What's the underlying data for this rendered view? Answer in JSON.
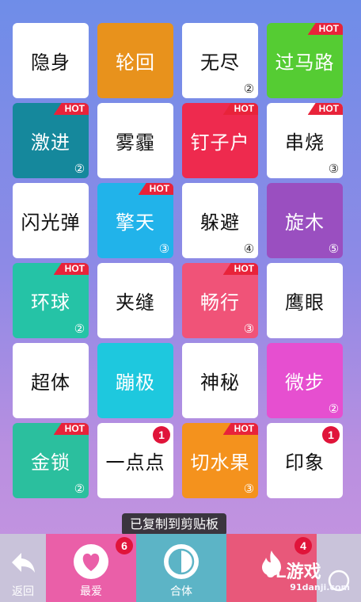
{
  "tiles": [
    {
      "word": "隐身",
      "bg": "#ffffff",
      "fg": "#111111",
      "hot": false,
      "level": "",
      "badge": ""
    },
    {
      "word": "轮回",
      "bg": "#e8921c",
      "fg": "#ffffff",
      "hot": false,
      "level": "",
      "badge": ""
    },
    {
      "word": "无尽",
      "bg": "#ffffff",
      "fg": "#111111",
      "hot": false,
      "level": "②",
      "badge": ""
    },
    {
      "word": "过马路",
      "bg": "#55cc33",
      "fg": "#ffffff",
      "hot": true,
      "level": "",
      "badge": ""
    },
    {
      "word": "激进",
      "bg": "#15889c",
      "fg": "#ffffff",
      "hot": true,
      "level": "②",
      "badge": ""
    },
    {
      "word": "雾霾",
      "bg": "#ffffff",
      "fg": "#111111",
      "hot": false,
      "level": "",
      "badge": ""
    },
    {
      "word": "钉子户",
      "bg": "#ee2a4e",
      "fg": "#ffffff",
      "hot": true,
      "level": "",
      "badge": ""
    },
    {
      "word": "串烧",
      "bg": "#ffffff",
      "fg": "#111111",
      "hot": true,
      "level": "③",
      "badge": ""
    },
    {
      "word": "闪光弹",
      "bg": "#ffffff",
      "fg": "#111111",
      "hot": false,
      "level": "",
      "badge": ""
    },
    {
      "word": "擎天",
      "bg": "#21b3ea",
      "fg": "#ffffff",
      "hot": true,
      "level": "③",
      "badge": ""
    },
    {
      "word": "躲避",
      "bg": "#ffffff",
      "fg": "#111111",
      "hot": false,
      "level": "④",
      "badge": ""
    },
    {
      "word": "旋木",
      "bg": "#9a4fc0",
      "fg": "#ffffff",
      "hot": false,
      "level": "⑤",
      "badge": ""
    },
    {
      "word": "环球",
      "bg": "#25c3a6",
      "fg": "#ffffff",
      "hot": true,
      "level": "②",
      "badge": ""
    },
    {
      "word": "夹缝",
      "bg": "#ffffff",
      "fg": "#111111",
      "hot": false,
      "level": "",
      "badge": ""
    },
    {
      "word": "畅行",
      "bg": "#f05378",
      "fg": "#ffffff",
      "hot": true,
      "level": "③",
      "badge": ""
    },
    {
      "word": "鹰眼",
      "bg": "#ffffff",
      "fg": "#111111",
      "hot": false,
      "level": "",
      "badge": ""
    },
    {
      "word": "超体",
      "bg": "#ffffff",
      "fg": "#111111",
      "hot": false,
      "level": "",
      "badge": ""
    },
    {
      "word": "蹦极",
      "bg": "#1ec8de",
      "fg": "#ffffff",
      "hot": false,
      "level": "",
      "badge": ""
    },
    {
      "word": "神秘",
      "bg": "#ffffff",
      "fg": "#111111",
      "hot": false,
      "level": "",
      "badge": ""
    },
    {
      "word": "微步",
      "bg": "#e64fd0",
      "fg": "#ffffff",
      "hot": false,
      "level": "②",
      "badge": ""
    },
    {
      "word": "金锁",
      "bg": "#2bbf9e",
      "fg": "#ffffff",
      "hot": true,
      "level": "②",
      "badge": ""
    },
    {
      "word": "一点点",
      "bg": "#ffffff",
      "fg": "#111111",
      "hot": false,
      "level": "",
      "badge": "1"
    },
    {
      "word": "切水果",
      "bg": "#f4921d",
      "fg": "#ffffff",
      "hot": true,
      "level": "③",
      "badge": ""
    },
    {
      "word": "印象",
      "bg": "#ffffff",
      "fg": "#111111",
      "hot": false,
      "level": "",
      "badge": "1"
    }
  ],
  "hot_label": "HOT",
  "toast": "已复制到剪贴板",
  "bottom": {
    "back_label": "返回",
    "favorite_label": "最爱",
    "favorite_count": "6",
    "combine_label": "合体",
    "hot_count": "4"
  },
  "watermark": {
    "logo": "9L游戏",
    "site": "91danji.com"
  },
  "icons": {
    "back": "back-arrow-icon",
    "favorite": "heart-icon",
    "combine": "half-circle-icon",
    "hot": "flame-icon",
    "more": "circle-icon"
  }
}
